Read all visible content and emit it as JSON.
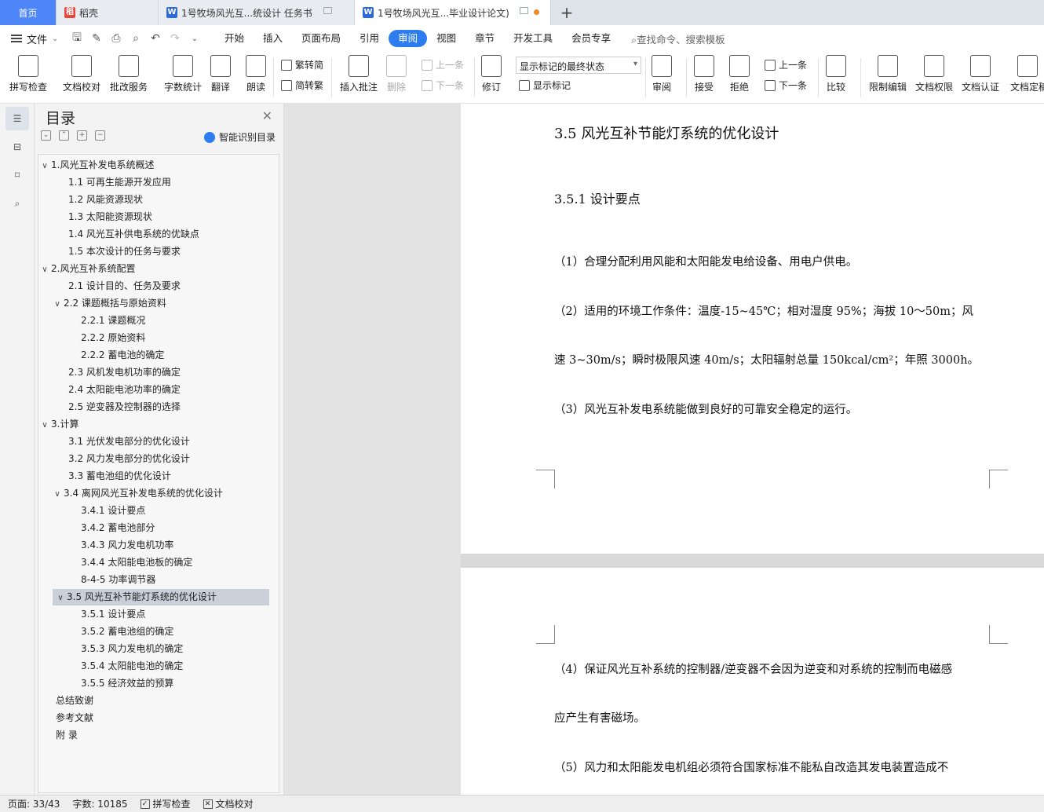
{
  "tabs": {
    "home": "首页",
    "daoke": "稻壳",
    "doc1": "1号牧场风光互...统设计 任务书",
    "doc2": "1号牧场风光互...毕业设计论文)"
  },
  "menu": {
    "file": "文件",
    "tabs": [
      "开始",
      "插入",
      "页面布局",
      "引用",
      "审阅",
      "视图",
      "章节",
      "开发工具",
      "会员专享"
    ],
    "active_tab": "审阅",
    "search": "查找命令、搜索模板"
  },
  "ribbon": {
    "spell": "拼写检查",
    "proof": "文档校对",
    "batch": "批改服务",
    "wordcount": "字数统计",
    "translate": "翻译",
    "read": "朗读",
    "to_trad": "繁转简",
    "to_simp": "简转繁",
    "insert_comment": "插入批注",
    "delete": "删除",
    "prev_comment": "上一条",
    "next_comment": "下一条",
    "revise": "修订",
    "display_mode": "显示标记的最终状态",
    "show_markup": "显示标记",
    "review": "审阅",
    "accept": "接受",
    "reject": "拒绝",
    "prev_change": "上一条",
    "next_change": "下一条",
    "compare": "比较",
    "restrict": "限制编辑",
    "permission": "文档权限",
    "certify": "文档认证",
    "finalize": "文档定稿"
  },
  "toc": {
    "title": "目录",
    "smart": "智能识别目录",
    "items": [
      {
        "label": "1.风光互补发电系统概述",
        "level": 1,
        "caret": "v"
      },
      {
        "label": "1.1  可再生能源开发应用",
        "level": 2
      },
      {
        "label": "1.2  风能资源现状",
        "level": 2
      },
      {
        "label": "1.3  太阳能资源现状",
        "level": 2
      },
      {
        "label": "1.4  风光互补供电系统的优缺点",
        "level": 2
      },
      {
        "label": "1.5 本次设计的任务与要求",
        "level": 2
      },
      {
        "label": "2.风光互补系统配置",
        "level": 1,
        "caret": "v"
      },
      {
        "label": "2.1 设计目的、任务及要求",
        "level": 2
      },
      {
        "label": "2.2 课题概括与原始资料",
        "level": 2,
        "caret": "v"
      },
      {
        "label": "2.2.1 课题概况",
        "level": 3
      },
      {
        "label": "2.2.2 原始资料",
        "level": 3
      },
      {
        "label": "2.2.2 蓄电池的确定",
        "level": 3
      },
      {
        "label": "2.3 风机发电机功率的确定",
        "level": 2
      },
      {
        "label": "2.4 太阳能电池功率的确定",
        "level": 2
      },
      {
        "label": "2.5 逆变器及控制器的选择",
        "level": 2
      },
      {
        "label": "3.计算",
        "level": 1,
        "caret": "v"
      },
      {
        "label": "3.1 光伏发电部分的优化设计",
        "level": 2
      },
      {
        "label": "3.2 风力发电部分的优化设计",
        "level": 2
      },
      {
        "label": "3.3 蓄电池组的优化设计",
        "level": 2
      },
      {
        "label": "3.4  离网风光互补发电系统的优化设计",
        "level": 2,
        "caret": "v"
      },
      {
        "label": "3.4.1 设计要点",
        "level": 3
      },
      {
        "label": "3.4.2 蓄电池部分",
        "level": 3
      },
      {
        "label": "3.4.3 风力发电机功率",
        "level": 3
      },
      {
        "label": "3.4.4 太阳能电池板的确定",
        "level": 3
      },
      {
        "label": "8-4-5 功率调节器",
        "level": 3
      },
      {
        "label": "3.5  风光互补节能灯系统的优化设计",
        "level": 2,
        "caret": "v",
        "selected": true
      },
      {
        "label": "3.5.1 设计要点",
        "level": 3
      },
      {
        "label": "3.5.2 蓄电池组的确定",
        "level": 3
      },
      {
        "label": "3.5.3 风力发电机的确定",
        "level": 3
      },
      {
        "label": "3.5.4 太阳能电池的确定",
        "level": 3
      },
      {
        "label": "3.5.5 经济效益的预算",
        "level": 3
      },
      {
        "label": "总结致谢",
        "level": 1
      },
      {
        "label": "参考文献",
        "level": 1
      },
      {
        "label": "附  录",
        "level": 1
      }
    ]
  },
  "document": {
    "heading": "3.5  风光互补节能灯系统的优化设计",
    "subheading": "3.5.1 设计要点",
    "para1": "（1）合理分配利用风能和太阳能发电给设备、用电户供电。",
    "para2a": "（2）适用的环境工作条件：温度-15~45℃；相对湿度 95%；海拔 10～50m；风",
    "para2b": "速 3~30m/s；瞬时极限风速 40m/s；太阳辐射总量 150kcal/cm²；年照 3000h。",
    "para3": "（3）风光互补发电系统能做到良好的可靠安全稳定的运行。",
    "para4a": "（4）保证风光互补系统的控制器/逆变器不会因为逆变和对系统的控制而电磁感",
    "para4b": "应产生有害磁场。",
    "para5": "（5）风力和太阳能发电机组必须符合国家标准不能私自改造其发电装置造成不"
  },
  "status": {
    "page": "页面: 33/43",
    "words": "字数: 10185",
    "spell": "拼写检查",
    "proof": "文档校对"
  }
}
